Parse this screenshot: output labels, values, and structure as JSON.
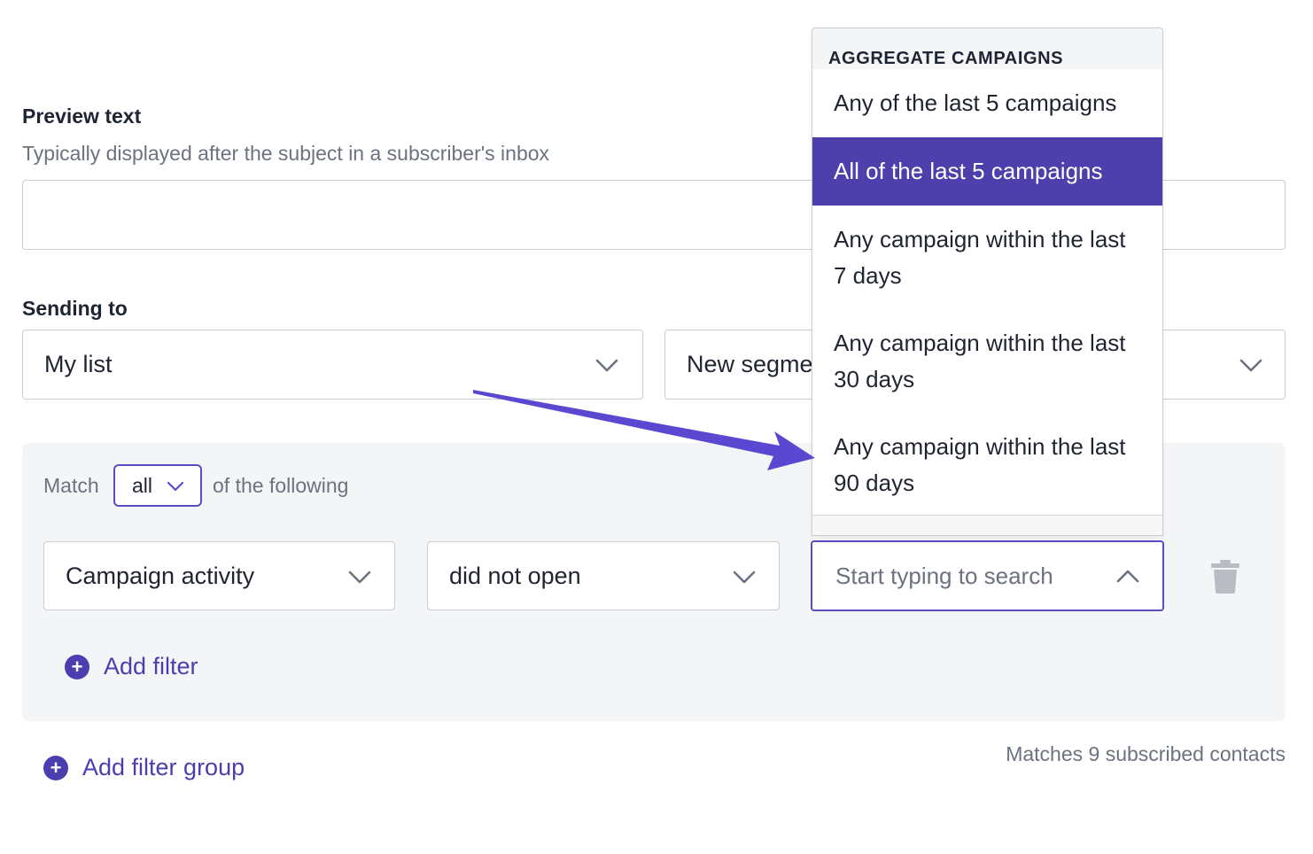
{
  "preview_text": {
    "label": "Preview text",
    "help": "Typically displayed after the subject in a subscriber's inbox",
    "value": ""
  },
  "sending_to": {
    "label": "Sending to",
    "list_value": "My list",
    "segment_value": "New segment"
  },
  "filter_group": {
    "match_prefix": "Match",
    "match_value": "all",
    "match_suffix": "of the following",
    "filter": {
      "field": "Campaign activity",
      "operator": "did not open",
      "search_placeholder": "Start typing to search"
    },
    "add_filter_label": "Add filter"
  },
  "add_filter_group_label": "Add filter group",
  "matches_text": "Matches 9 subscribed contacts",
  "dropdown": {
    "header": "AGGREGATE CAMPAIGNS",
    "items": [
      {
        "line1": "Any of the last 5 campaigns",
        "line2": ""
      },
      {
        "line1": "All of the last 5 campaigns",
        "line2": ""
      },
      {
        "line1": "Any campaign within the last",
        "line2": "7 days"
      },
      {
        "line1": "Any campaign within the last",
        "line2": "30 days"
      },
      {
        "line1": "Any campaign within the last",
        "line2": "90 days"
      }
    ]
  },
  "icons": {
    "chevron": "chevron-down-icon",
    "chevron_up": "chevron-up-icon",
    "trash": "trash-icon",
    "plus": "plus-circle-icon",
    "arrow": "annotation-arrow-icon"
  },
  "colors": {
    "accent": "#4d40ad",
    "arrow": "#5b48d0",
    "panel": "#f4f5f6",
    "muted_text": "#6b7280"
  }
}
